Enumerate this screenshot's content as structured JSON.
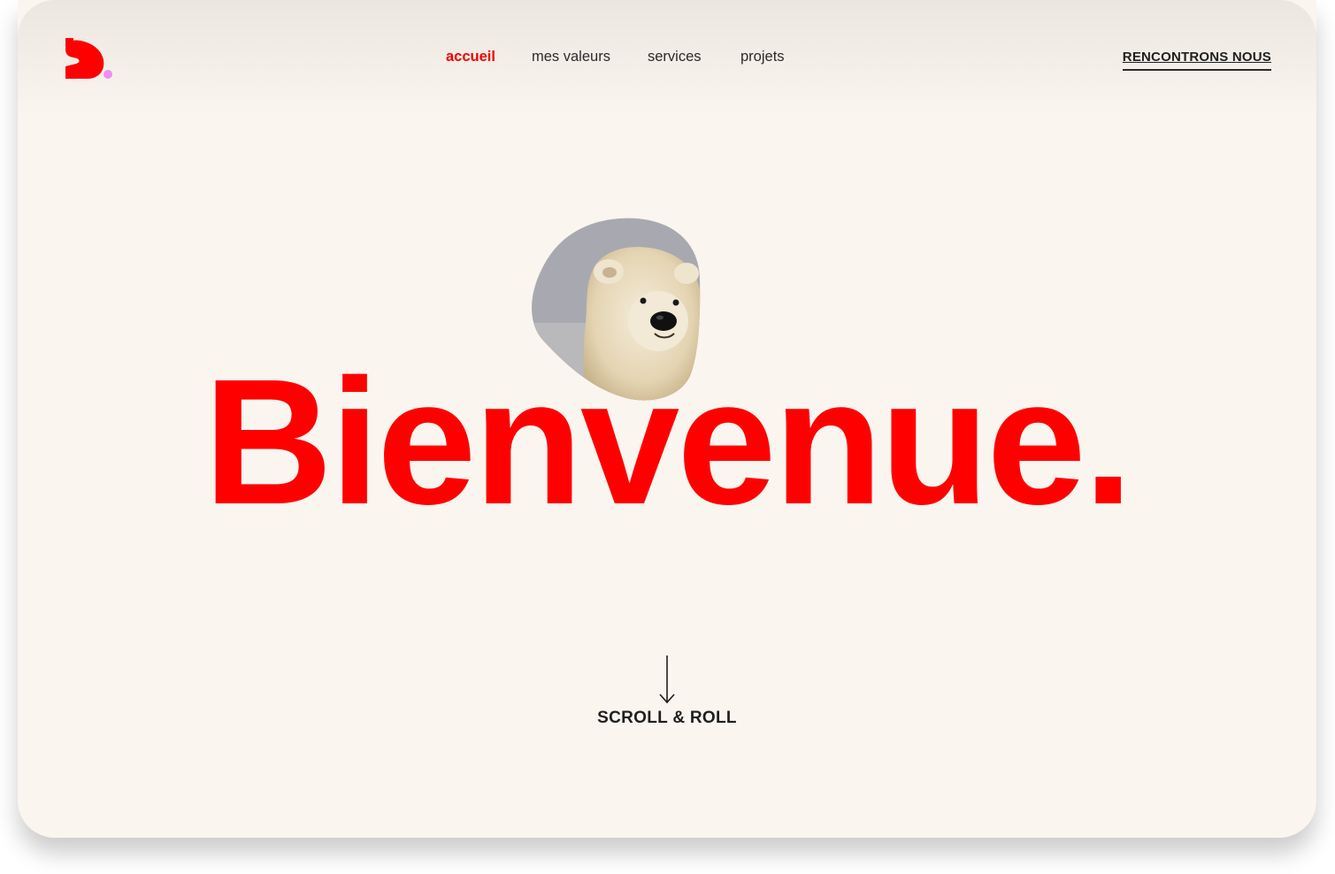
{
  "colors": {
    "accent": "#ff0000",
    "background": "#fbf5ef",
    "text": "#2b2b2b",
    "logo_dot": "#f38cf0"
  },
  "logo": {
    "icon": "brand-logo-icon"
  },
  "nav": {
    "items": [
      {
        "label": "accueil",
        "active": true
      },
      {
        "label": "mes valeurs",
        "active": false
      },
      {
        "label": "services",
        "active": false
      },
      {
        "label": "projets",
        "active": false
      }
    ]
  },
  "header": {
    "cta_label": "RENCONTRONS NOUS"
  },
  "hero": {
    "title": "Bienvenue.",
    "image_icon": "polar-bear-photo"
  },
  "scroll": {
    "label": "SCROLL & ROLL",
    "icon": "arrow-down-icon"
  }
}
